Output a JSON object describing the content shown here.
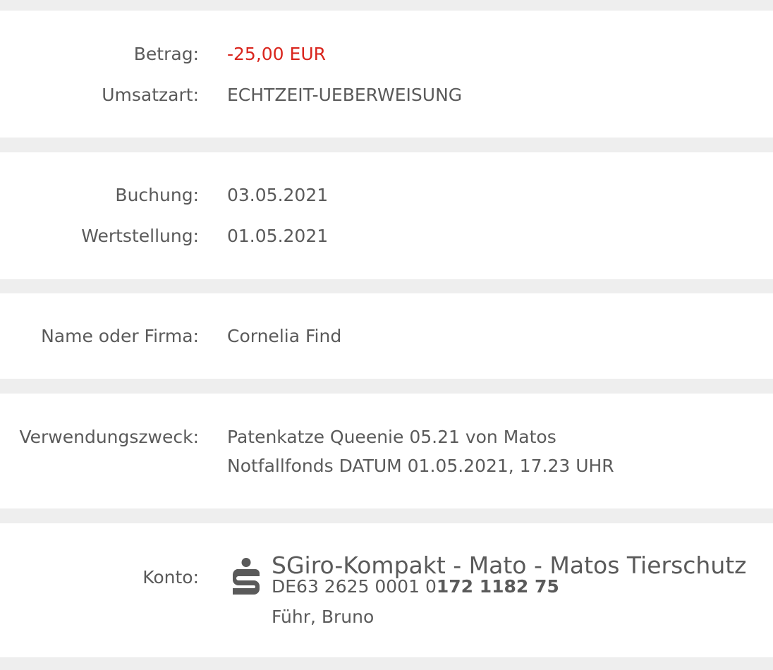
{
  "sections": {
    "amount": {
      "betrag_label": "Betrag:",
      "betrag_value": "-25,00 EUR",
      "umsatzart_label": "Umsatzart:",
      "umsatzart_value": "ECHTZEIT-UEBERWEISUNG"
    },
    "dates": {
      "buchung_label": "Buchung:",
      "buchung_value": "03.05.2021",
      "wertstellung_label": "Wertstellung:",
      "wertstellung_value": "01.05.2021"
    },
    "name": {
      "label": "Name oder Firma:",
      "value": "Cornelia Find"
    },
    "purpose": {
      "label": "Verwendungszweck:",
      "line1": "Patenkatze Queenie 05.21 von Matos",
      "line2": "Notfallfonds DATUM 01.05.2021, 17.23 UHR"
    },
    "account": {
      "label": "Konto:",
      "icon": "sparkasse-logo-icon",
      "title": "SGiro-Kompakt - Mato - Matos Tierschutz",
      "iban_prefix": "DE63 2625 0001 0",
      "iban_bold": "172 1182 75",
      "owner": "Führ, Bruno"
    }
  },
  "colors": {
    "background": "#eeeeee",
    "card": "#ffffff",
    "text": "#5a5a5a",
    "negative_amount": "#d9251d"
  }
}
